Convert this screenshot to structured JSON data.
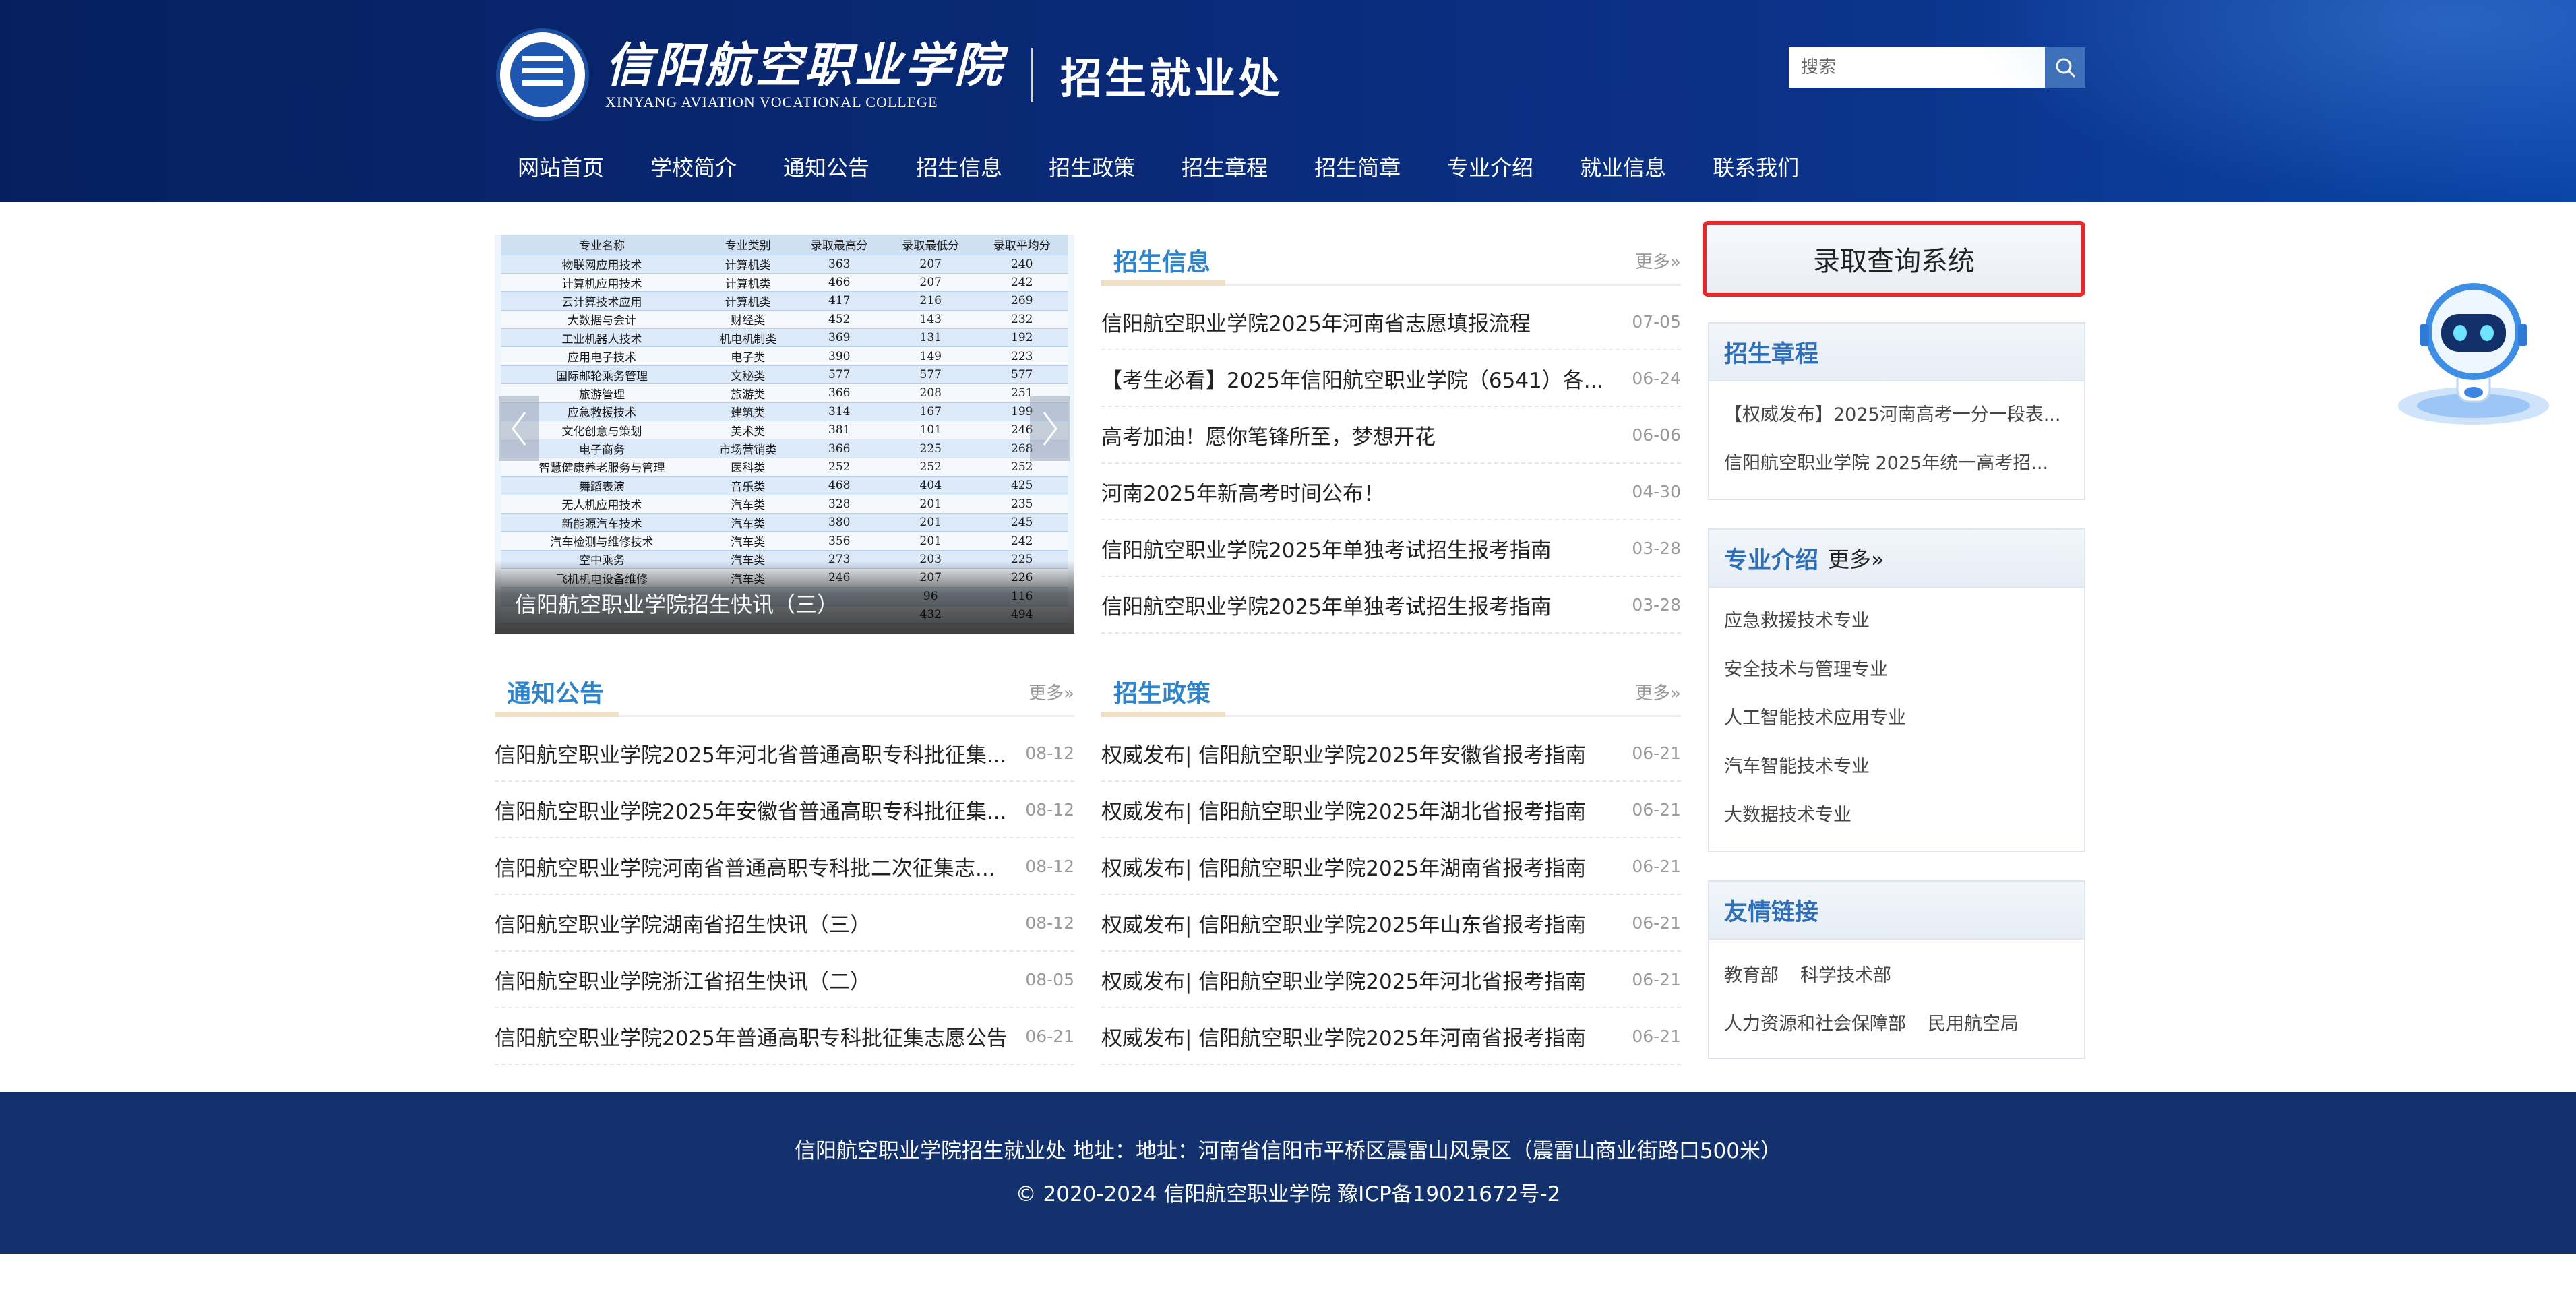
{
  "colors": {
    "header_bg": "#0a2a78",
    "nav_text": "#ffffff",
    "section_title": "#2e83c9",
    "section_accent": "#f1dfc6",
    "sidebar_title": "#2f6fb8",
    "query_border": "#e82828",
    "footer_bg": "#13316c"
  },
  "header": {
    "logo_cn": "信阳航空职业学院",
    "logo_en": "XINYANG AVIATION VOCATIONAL COLLEGE",
    "dept_title": "招生就业处",
    "search_placeholder": "搜索",
    "search_icon": "search-icon"
  },
  "nav": {
    "items": [
      {
        "label": "网站首页"
      },
      {
        "label": "学校简介"
      },
      {
        "label": "通知公告"
      },
      {
        "label": "招生信息"
      },
      {
        "label": "招生政策"
      },
      {
        "label": "招生章程"
      },
      {
        "label": "招生简章"
      },
      {
        "label": "专业介绍"
      },
      {
        "label": "就业信息"
      },
      {
        "label": "联系我们"
      }
    ]
  },
  "slider": {
    "caption": "信阳航空职业学院招生快讯（三）",
    "prev_icon": "chevron-left-icon",
    "next_icon": "chevron-right-icon",
    "table": {
      "headers": [
        "专业名称",
        "专业类别",
        "录取最高分",
        "录取最低分",
        "录取平均分"
      ],
      "rows": [
        [
          "物联网应用技术",
          "计算机类",
          "363",
          "207",
          "240"
        ],
        [
          "计算机应用技术",
          "计算机类",
          "466",
          "207",
          "242"
        ],
        [
          "云计算技术应用",
          "计算机类",
          "417",
          "216",
          "269"
        ],
        [
          "大数据与会计",
          "财经类",
          "452",
          "143",
          "232"
        ],
        [
          "工业机器人技术",
          "机电机制类",
          "369",
          "131",
          "192"
        ],
        [
          "应用电子技术",
          "电子类",
          "390",
          "149",
          "223"
        ],
        [
          "国际邮轮乘务管理",
          "文秘类",
          "577",
          "577",
          "577"
        ],
        [
          "旅游管理",
          "旅游类",
          "366",
          "208",
          "251"
        ],
        [
          "应急救援技术",
          "建筑类",
          "314",
          "167",
          "199"
        ],
        [
          "文化创意与策划",
          "美术类",
          "381",
          "101",
          "246"
        ],
        [
          "电子商务",
          "市场营销类",
          "366",
          "225",
          "268"
        ],
        [
          "智慧健康养老服务与管理",
          "医科类",
          "252",
          "252",
          "252"
        ],
        [
          "舞蹈表演",
          "音乐类",
          "468",
          "404",
          "425"
        ],
        [
          "无人机应用技术",
          "汽车类",
          "328",
          "201",
          "235"
        ],
        [
          "新能源汽车技术",
          "汽车类",
          "380",
          "201",
          "245"
        ],
        [
          "汽车检测与维修技术",
          "汽车类",
          "356",
          "201",
          "242"
        ],
        [
          "空中乘务",
          "汽车类",
          "273",
          "203",
          "225"
        ],
        [
          "飞机机电设备维修",
          "汽车类",
          "246",
          "207",
          "226"
        ],
        [
          "",
          "",
          "",
          "96",
          "116"
        ],
        [
          "",
          "",
          "",
          "432",
          "494"
        ]
      ]
    }
  },
  "admissions_info": {
    "title": "招生信息",
    "more": "更多»",
    "items": [
      {
        "text": "信阳航空职业学院2025年河南省志愿填报流程",
        "date": "07-05"
      },
      {
        "text": "【考生必看】2025年信阳航空职业学院（6541）各...",
        "date": "06-24"
      },
      {
        "text": "高考加油！愿你笔锋所至，梦想开花",
        "date": "06-06"
      },
      {
        "text": "河南2025年新高考时间公布！",
        "date": "04-30"
      },
      {
        "text": "信阳航空职业学院2025年单独考试招生报考指南",
        "date": "03-28"
      },
      {
        "text": "信阳航空职业学院2025年单独考试招生报考指南",
        "date": "03-28"
      }
    ]
  },
  "notices": {
    "title": "通知公告",
    "more": "更多»",
    "items": [
      {
        "text": "信阳航空职业学院2025年河北省普通高职专科批征集...",
        "date": "08-12"
      },
      {
        "text": "信阳航空职业学院2025年安徽省普通高职专科批征集...",
        "date": "08-12"
      },
      {
        "text": "信阳航空职业学院河南省普通高职专科批二次征集志...",
        "date": "08-12"
      },
      {
        "text": "信阳航空职业学院湖南省招生快讯（三）",
        "date": "08-12"
      },
      {
        "text": "信阳航空职业学院浙江省招生快讯（二）",
        "date": "08-05"
      },
      {
        "text": "信阳航空职业学院2025年普通高职专科批征集志愿公告",
        "date": "06-21"
      }
    ]
  },
  "policies": {
    "title": "招生政策",
    "more": "更多»",
    "items": [
      {
        "text": "权威发布| 信阳航空职业学院2025年安徽省报考指南",
        "date": "06-21"
      },
      {
        "text": "权威发布| 信阳航空职业学院2025年湖北省报考指南",
        "date": "06-21"
      },
      {
        "text": "权威发布| 信阳航空职业学院2025年湖南省报考指南",
        "date": "06-21"
      },
      {
        "text": "权威发布| 信阳航空职业学院2025年山东省报考指南",
        "date": "06-21"
      },
      {
        "text": "权威发布| 信阳航空职业学院2025年河北省报考指南",
        "date": "06-21"
      },
      {
        "text": "权威发布| 信阳航空职业学院2025年河南省报考指南",
        "date": "06-21"
      }
    ]
  },
  "sidebar": {
    "query_button": "录取查询系统",
    "charter": {
      "title": "招生章程",
      "items": [
        "【权威发布】2025河南高考一分一段表...",
        "信阳航空职业学院 2025年统一高考招..."
      ]
    },
    "majors": {
      "title": "专业介绍",
      "more": "更多»",
      "items": [
        "应急救援技术专业",
        "安全技术与管理专业",
        "人工智能技术应用专业",
        "汽车智能技术专业",
        "大数据技术专业"
      ]
    },
    "links": {
      "title": "友情链接",
      "items": [
        "教育部",
        "科学技术部",
        "人力资源和社会保障部",
        "民用航空局"
      ]
    }
  },
  "robot": {
    "icon": "chat-robot-icon"
  },
  "footer": {
    "line1": "信阳航空职业学院招生就业处 地址：地址：河南省信阳市平桥区震雷山风景区（震雷山商业街路口500米）",
    "line2": "© 2020-2024 信阳航空职业学院 豫ICP备19021672号-2"
  }
}
